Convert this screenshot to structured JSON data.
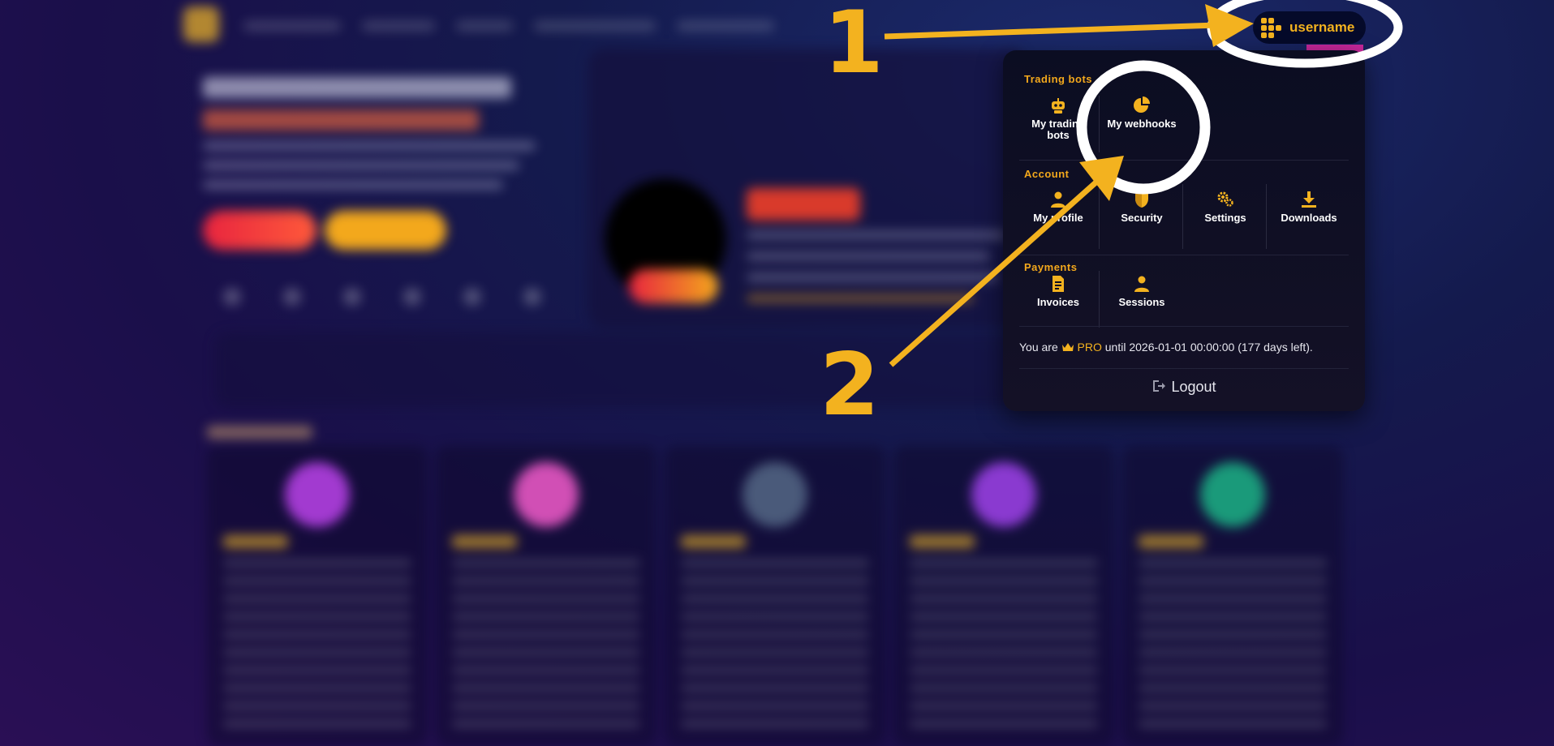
{
  "header": {
    "username": "username"
  },
  "menu": {
    "sections": {
      "trading_bots": "Trading bots",
      "account": "Account",
      "payments": "Payments"
    },
    "items": {
      "my_trading_bots": "My trading bots",
      "my_webhooks": "My webhooks",
      "my_profile": "My profile",
      "security": "Security",
      "settings": "Settings",
      "downloads": "Downloads",
      "invoices": "Invoices",
      "sessions": "Sessions"
    },
    "status": {
      "prefix": "You are",
      "plan": "PRO",
      "suffix": "until 2026-01-01 00:00:00 (177 days left)."
    },
    "logout": "Logout"
  },
  "annotations": {
    "step1": "1",
    "step2": "2"
  },
  "colors": {
    "accent": "#f3b21f",
    "menu_bg": "#0b0d22",
    "page_bg": "#141a4d"
  },
  "icons": [
    "robot-icon",
    "pie-chart-icon",
    "user-icon",
    "shield-icon",
    "gears-icon",
    "download-icon",
    "invoice-icon",
    "sessions-icon",
    "crown-icon",
    "logout-icon",
    "logo-grid-icon"
  ]
}
